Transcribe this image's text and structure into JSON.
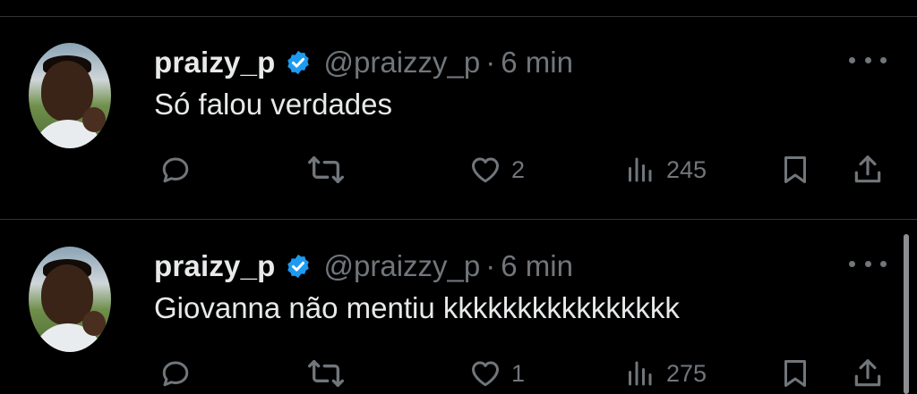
{
  "colors": {
    "background": "#000000",
    "text": "#e7e9ea",
    "muted": "#71767b",
    "verified": "#1d9bf0",
    "divider": "#2f3336"
  },
  "tweets": [
    {
      "username": "praizy_p",
      "handle": "@praizzy_p",
      "separator": "·",
      "time": "6 min",
      "text": "Só falou verdades",
      "reply_count": "",
      "retweet_count": "",
      "like_count": "2",
      "view_count": "245"
    },
    {
      "username": "praizy_p",
      "handle": "@praizzy_p",
      "separator": "·",
      "time": "6 min",
      "text": "Giovanna não mentiu kkkkkkkkkkkkkkkk",
      "reply_count": "",
      "retweet_count": "",
      "like_count": "1",
      "view_count": "275"
    }
  ],
  "icons": {
    "reply": "reply-icon",
    "retweet": "retweet-icon",
    "like": "heart-icon",
    "views": "views-icon",
    "bookmark": "bookmark-icon",
    "share": "share-icon",
    "more": "more-icon",
    "verified": "verified-badge-icon"
  }
}
